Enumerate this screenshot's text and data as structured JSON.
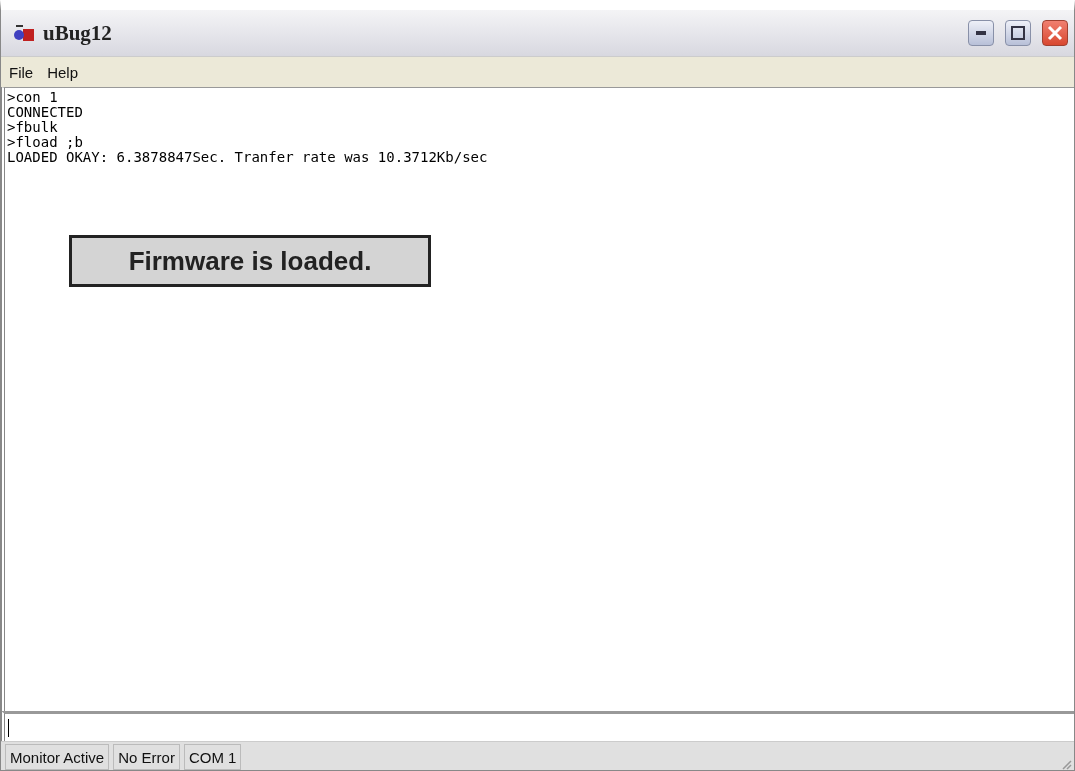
{
  "window": {
    "title": "uBug12"
  },
  "menu": [
    "File",
    "Help"
  ],
  "console": {
    "lines": [
      ">con 1",
      "CONNECTED",
      ">fbulk",
      ">fload ;b",
      "LOADED OKAY: 6.3878847Sec. Tranfer rate was 10.3712Kb/sec"
    ]
  },
  "callout": {
    "text": "Firmware is loaded."
  },
  "status_bar": [
    "Monitor Active",
    "No Error",
    "COM 1"
  ]
}
